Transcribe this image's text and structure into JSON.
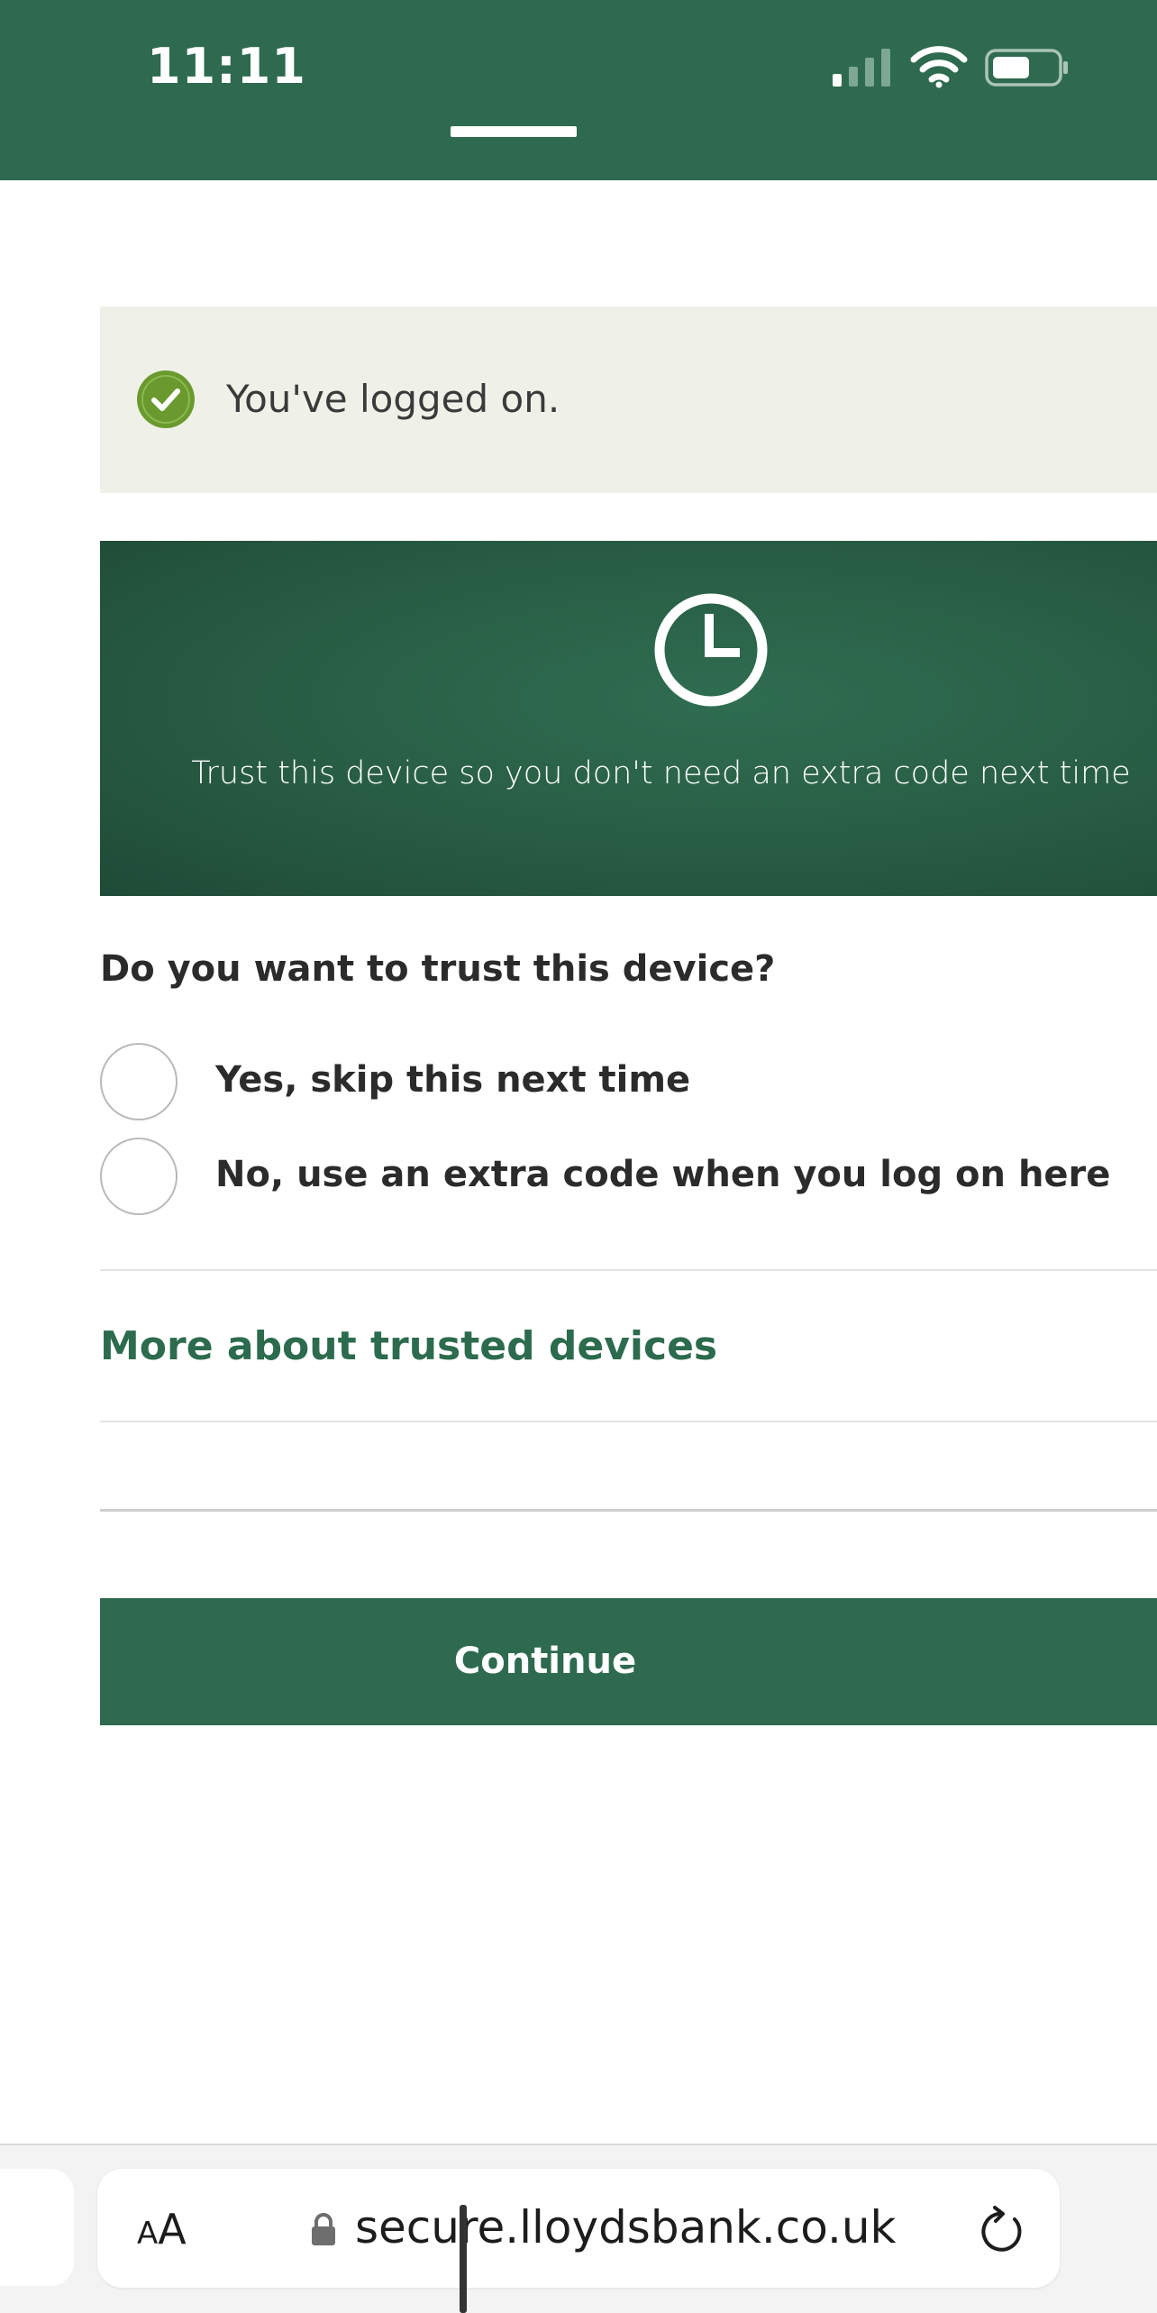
{
  "status_bar": {
    "time": "11:11",
    "icons": [
      "signal-icon",
      "wifi-icon",
      "battery-icon"
    ]
  },
  "banner": {
    "icon": "check-circle-icon",
    "message": "You've logged on."
  },
  "hero": {
    "icon": "clock-icon",
    "text": "Trust this device so you don't need an extra code next time"
  },
  "form": {
    "question": "Do you want to trust this device?",
    "options": [
      {
        "label": "Yes, skip this next time",
        "selected": false
      },
      {
        "label": "No, use an extra code when you log on here",
        "selected": false
      }
    ]
  },
  "links": {
    "more_about": "More about trusted devices"
  },
  "actions": {
    "continue_label": "Continue"
  },
  "browser": {
    "text_size_small": "A",
    "text_size_large": "A",
    "url": "secure.lloydsbank.co.uk",
    "icons": [
      "lock-icon",
      "reload-icon"
    ]
  },
  "colors": {
    "brand_green": "#2e6a4f",
    "banner_bg": "#eff1e8",
    "success_green": "#6a9a2e",
    "link_green": "#2c6b4e"
  }
}
